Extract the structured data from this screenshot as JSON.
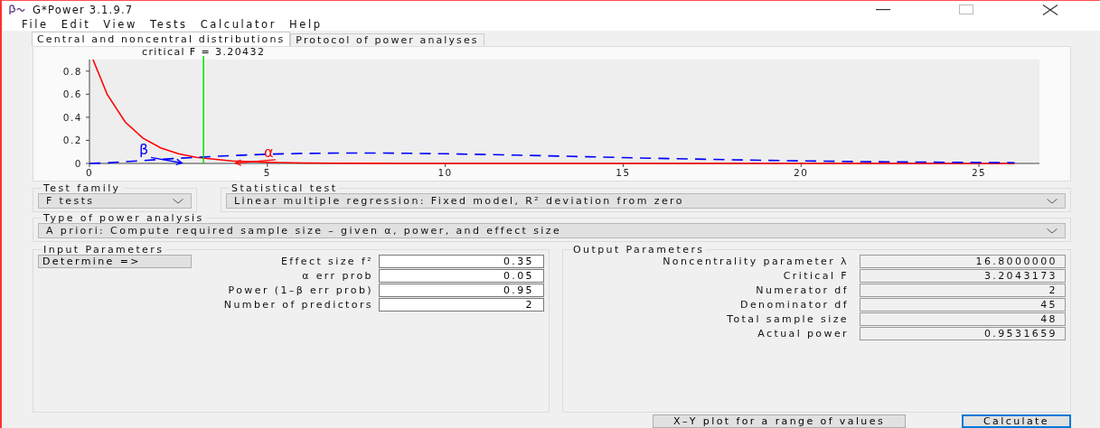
{
  "window": {
    "title": "G*Power 3.1.9.7"
  },
  "menu": [
    "File",
    "Edit",
    "View",
    "Tests",
    "Calculator",
    "Help"
  ],
  "tabs": [
    {
      "label": "Central and noncentral distributions",
      "selected": true
    },
    {
      "label": "Protocol of power analyses",
      "selected": false
    }
  ],
  "plot": {
    "chart_data": {
      "type": "line",
      "x": [
        0,
        0.1,
        0.5,
        1,
        1.5,
        2,
        2.5,
        3,
        4,
        5,
        6,
        7,
        8,
        9,
        10,
        12,
        14,
        16,
        18,
        20,
        22,
        24,
        26
      ],
      "series": [
        {
          "color": "#ff0000",
          "values": [
            null,
            0.9,
            0.597,
            0.36,
            0.22,
            0.135,
            0.084,
            0.053,
            0.021,
            0.009,
            0.004,
            0.002,
            0.001,
            0,
            0,
            0,
            0,
            0,
            0,
            0,
            0,
            0,
            0
          ]
        },
        {
          "color": "#0000ff",
          "line_style": "dashed",
          "values": [
            0,
            0.001,
            0.005,
            0.015,
            0.025,
            0.035,
            0.045,
            0.053,
            0.068,
            0.08,
            0.087,
            0.09,
            0.09,
            0.088,
            0.084,
            0.072,
            0.058,
            0.044,
            0.032,
            0.022,
            0.015,
            0.01,
            0.006
          ]
        }
      ],
      "xlim": [
        0,
        26.7
      ],
      "ylim": [
        0,
        0.9
      ],
      "xticks": [
        0,
        5,
        10,
        15,
        20,
        25
      ],
      "yticks": [
        0,
        0.2,
        0.4,
        0.6,
        0.8
      ],
      "ref_lines": [
        {
          "axis": "x",
          "value": 3.20432,
          "label": "critical F = 3.20432",
          "color": "#00e000"
        }
      ],
      "annotations": [
        "β",
        "α"
      ]
    }
  },
  "test_family": {
    "label": "Test family",
    "value": "F tests"
  },
  "statistical_test": {
    "label": "Statistical test",
    "value": "Linear multiple regression: Fixed model, R² deviation from zero"
  },
  "power_analysis_type": {
    "label": "Type of power analysis",
    "value": "A priori: Compute required sample size – given α, power, and effect size"
  },
  "input_parameters": {
    "title": "Input Parameters",
    "determine_button": "Determine =>",
    "fields": [
      {
        "label": "Effect size f²",
        "value": "0.35"
      },
      {
        "label": "α err prob",
        "value": "0.05"
      },
      {
        "label": "Power (1–β err prob)",
        "value": "0.95"
      },
      {
        "label": "Number of predictors",
        "value": "2"
      }
    ]
  },
  "output_parameters": {
    "title": "Output Parameters",
    "fields": [
      {
        "label": "Noncentrality parameter λ",
        "value": "16.8000000"
      },
      {
        "label": "Critical F",
        "value": "3.2043173"
      },
      {
        "label": "Numerator df",
        "value": "2"
      },
      {
        "label": "Denominator df",
        "value": "45"
      },
      {
        "label": "Total sample size",
        "value": "48"
      },
      {
        "label": "Actual power",
        "value": "0.9531659"
      }
    ]
  },
  "buttons": [
    {
      "label": "X–Y plot for a range of values",
      "default": false
    },
    {
      "label": "Calculate",
      "default": true
    }
  ]
}
